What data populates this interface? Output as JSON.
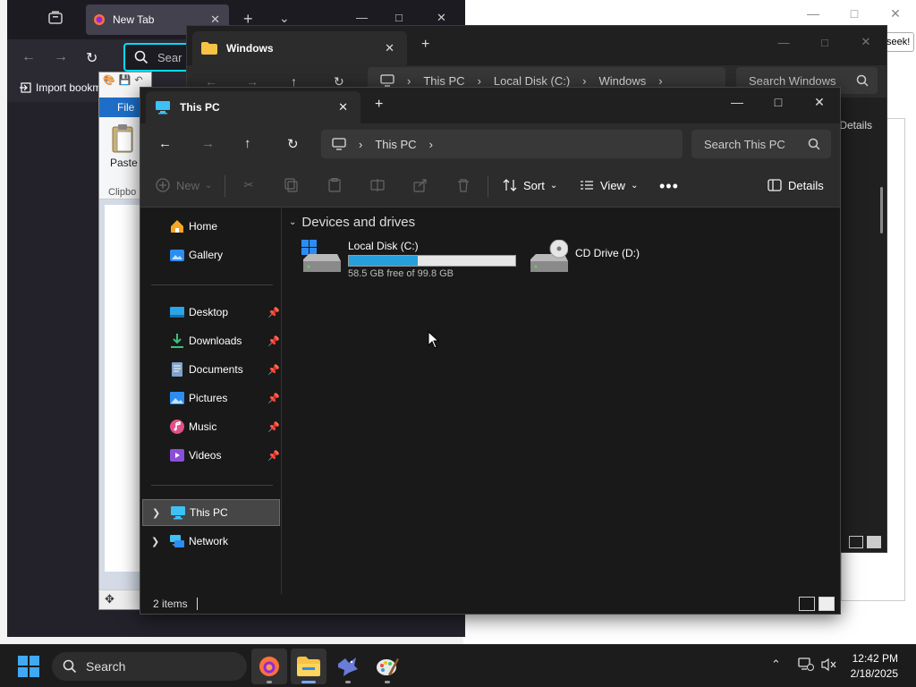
{
  "firefox": {
    "tab_title": "New Tab",
    "search_placeholder": "Sear",
    "bookmark_label": "Import bookm",
    "right_pill": "seek!"
  },
  "paint": {
    "file_tab": "File",
    "paste_label": "Paste",
    "clipboard_label": "Clipbo"
  },
  "explorer_bg": {
    "tab_title": "Windows",
    "breadcrumbs": [
      "This PC",
      "Local Disk (C:)",
      "Windows"
    ],
    "search_placeholder": "Search Windows",
    "details_label": "Details"
  },
  "explorer": {
    "tab_title": "This PC",
    "breadcrumbs": [
      "This PC"
    ],
    "search_placeholder": "Search This PC",
    "commands": {
      "new": "New",
      "sort": "Sort",
      "view": "View",
      "details": "Details"
    },
    "nav": {
      "home": "Home",
      "gallery": "Gallery",
      "desktop": "Desktop",
      "downloads": "Downloads",
      "documents": "Documents",
      "pictures": "Pictures",
      "music": "Music",
      "videos": "Videos",
      "this_pc": "This PC",
      "network": "Network"
    },
    "group_title": "Devices and drives",
    "drives": [
      {
        "name": "Local Disk (C:)",
        "free_text": "58.5 GB free of 99.8 GB",
        "used_fraction": 0.414
      },
      {
        "name": "CD Drive (D:)"
      }
    ],
    "status_text": "2 items"
  },
  "taskbar": {
    "search_label": "Search",
    "time": "12:42 PM",
    "date": "2/18/2025"
  },
  "colors": {
    "accent": "#26a0da",
    "taskbar_bg": "#1c1c1c",
    "window_bg": "#191919"
  }
}
